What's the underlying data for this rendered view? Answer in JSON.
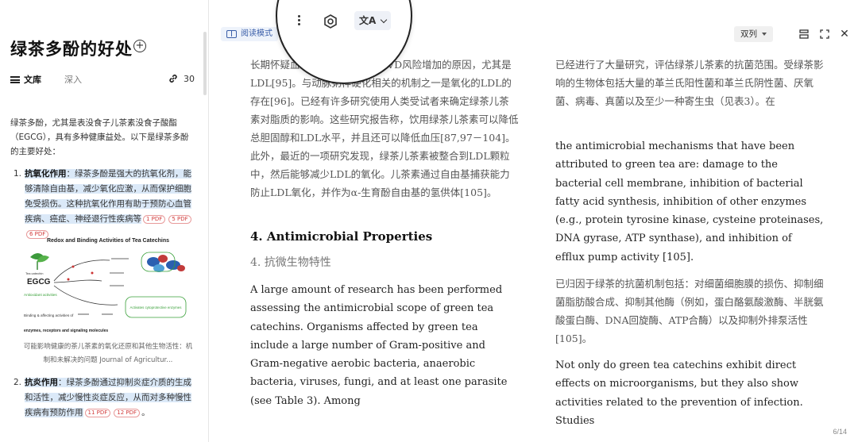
{
  "sidebar": {
    "title": "绿茶多酚的好处",
    "tabs": {
      "library": "文库",
      "deep": "深入",
      "links_count": "30"
    },
    "intro": "绿茶多酚，尤其是表没食子儿茶素没食子酸酯（EGCG），具有多种健康益处。以下是绿茶多酚的主要好处：",
    "items": [
      {
        "num": "1.",
        "title": "抗氧化作用",
        "text": "：绿茶多酚是强大的抗氧化剂，能够清除自由基，减少氧化应激，从而保护细胞免受损伤。这种抗氧化作用有助于预防心血管疾病、癌症、神经退行性疾病等",
        "refs": [
          "1 PDF",
          "5 PDF",
          "6 PDF"
        ]
      },
      {
        "num": "2.",
        "title": "抗炎作用",
        "text": "：绿茶多酚通过抑制炎症介质的生成和活性，减少慢性炎症反应，从而对多种慢性疾病有预防作用",
        "refs": [
          "11 PDF",
          "12 PDF"
        ],
        "tail": "。"
      }
    ],
    "figure": {
      "title": "Redox and Binding Activities of Tea Catechins",
      "egcg": "EGCG",
      "tea_catechin": "Tea catechin",
      "antioxidant": "Antioxidant activities",
      "binding": "Binding & affecting activities of",
      "enzymes": "enzymes, receptors and signaling molecules",
      "cyto": "Activates cytoprotective enzymes",
      "caption": "可能影响健康的茶儿茶素的氧化还原和其他生物活性：机制和未解决的问题 Journal of Agricultur..."
    }
  },
  "toolbar": {
    "read_mode": "阅读模式",
    "columns": "双列",
    "translate_glyph": "文A"
  },
  "doc": {
    "c1_top_zh": "长期怀疑血清脂质水平升高是CVD风险增加的原因，尤其是LDL[95]。与动脉粥样硬化相关的机制之一是氧化的LDL的存在[96]。已经有许多研究使用人类受试者来确定绿茶儿茶素对脂质的影响。这些研究报告称，饮用绿茶儿茶素可以降低总胆固醇和LDL水平，并且还可以降低血压[87,97－104]。此外，最近的一项研究发现，绿茶儿茶素被整合到LDL颗粒中，然后能够减少LDL的氧化。儿茶素通过自由基捕获能力防止LDL氧化，并作为α-生育酚自由基的氢供体[105]。",
    "c1_heading": "4. Antimicrobial Properties",
    "c1_heading_zh": "4. 抗微生物特性",
    "c1_en": "A large amount of research has been performed assessing the antimicrobial scope of green tea catechins. Organisms affected by green tea include a large number of Gram-positive and Gram-negative aerobic bacteria, anaerobic bacteria, viruses, fungi, and at least one parasite (see Table 3). Among",
    "c2_top_zh": "已经进行了大量研究，评估绿茶儿茶素的抗菌范围。受绿茶影响的生物体包括大量的革兰氏阳性菌和革兰氏阴性菌、厌氧菌、病毒、真菌以及至少一种寄生虫（见表3）。在",
    "c2_en1": "the antimicrobial mechanisms that have been attributed to green tea are: damage to the bacterial cell membrane, inhibition of bacterial fatty acid synthesis, inhibition of other enzymes (e.g., protein tyrosine kinase, cysteine proteinases, DNA gyrase, ATP synthase), and inhibition of efflux pump activity [105].",
    "c2_zh2": "已归因于绿茶的抗菌机制包括：对细菌细胞膜的损伤、抑制细菌脂肪酸合成、抑制其他酶（例如，蛋白酪氨酸激酶、半胱氨酸蛋白酶、DNA回旋酶、ATP合酶）以及抑制外排泵活性[105]。",
    "c2_en2": "Not only do green tea catechins exhibit direct effects on microorganisms, but they also show activities related to the prevention of infection. Studies",
    "page": "6/14"
  }
}
